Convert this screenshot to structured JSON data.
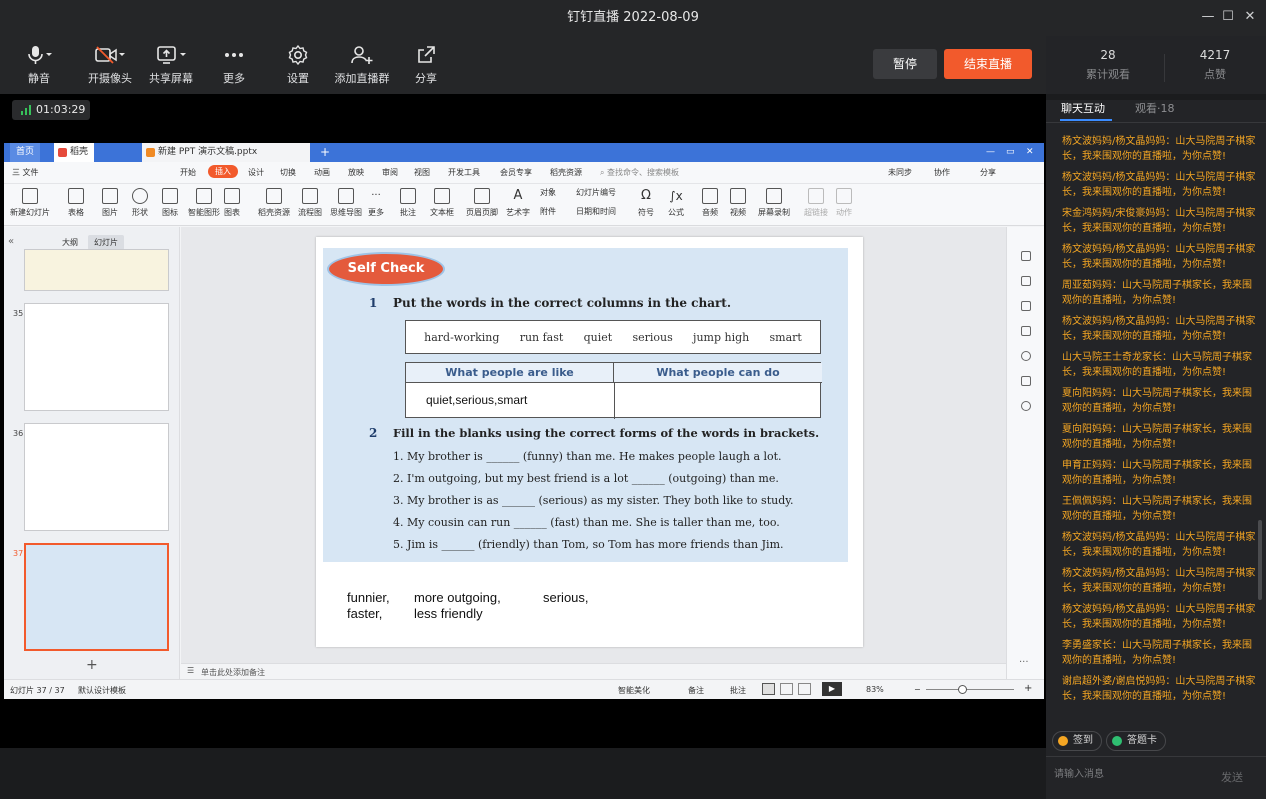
{
  "window": {
    "title": "钉钉直播 2022-08-09"
  },
  "toolbar": {
    "mute": "静音",
    "camera": "开摄像头",
    "share": "共享屏幕",
    "more": "更多",
    "settings": "设置",
    "add_group": "添加直播群",
    "share_link": "分享",
    "pause": "暂停",
    "end": "结束直播"
  },
  "stats": {
    "viewers": "28",
    "viewers_label": "累计观看",
    "likes": "4217",
    "likes_label": "点赞"
  },
  "timer": "01:03:29",
  "wps": {
    "tabs": {
      "home": "首页",
      "daoke": "稻壳",
      "doc": "新建 PPT 演示文稿.pptx"
    },
    "menu": [
      "三 文件",
      "开始",
      "插入",
      "设计",
      "切换",
      "动画",
      "放映",
      "审阅",
      "视图",
      "开发工具",
      "会员专享",
      "稻壳资源"
    ],
    "search": "查找命令、搜索模板",
    "right_menu": [
      "未同步",
      "协作",
      "分享"
    ],
    "ribbon": [
      "新建幻灯片",
      "表格",
      "图片",
      "形状",
      "图标",
      "智能图形",
      "图表",
      "稻壳资源",
      "流程图",
      "思维导图",
      "更多",
      "批注",
      "文本框",
      "页眉页脚",
      "艺术字",
      "对象",
      "幻灯片编号",
      "附件",
      "日期和时间",
      "符号",
      "公式",
      "音频",
      "视频",
      "屏幕录制",
      "超链接",
      "动作"
    ],
    "pane_tabs": {
      "outline": "大纲",
      "slides": "幻灯片"
    },
    "thumb_numbers": [
      "35",
      "36",
      "37"
    ],
    "notes_hint": "单击此处添加备注",
    "status": {
      "slide_count": "幻灯片 37 / 37",
      "template": "默认设计模板",
      "beautify": "智能美化",
      "notes": "备注",
      "comment": "批注",
      "zoom": "83%"
    }
  },
  "slide": {
    "self_check": "Self Check",
    "q1_num": "1",
    "q1_title": "Put the words in the correct columns in the chart.",
    "words": [
      "hard-working",
      "run fast",
      "quiet",
      "serious",
      "jump high",
      "smart"
    ],
    "col1": "What people are like",
    "col2": "What people can do",
    "col1_answer": "quiet,serious,smart",
    "q2_num": "2",
    "q2_title": "Fill in the blanks using the correct forms of the words in brackets.",
    "sentences": [
      "1. My brother is ______ (funny) than me. He makes people laugh a lot.",
      "2. I'm outgoing, but my best friend is a lot ______ (outgoing) than me.",
      "3. My brother is as ______ (serious) as my sister. They both like to study.",
      "4. My cousin can run ______ (fast) than me. She is taller than me, too.",
      "5. Jim is ______ (friendly) than Tom, so Tom has more friends than Jim."
    ],
    "answers_row1": [
      "funnier,",
      "more outgoing,",
      "serious,"
    ],
    "answers_row2": [
      "faster,",
      "less friendly"
    ]
  },
  "chat": {
    "tab_active": "聊天互动",
    "tab_watch": "观看·18",
    "messages": [
      "杨文波妈妈/杨文晶妈妈：山大马院周子棋家长，我来围观你的直播啦，为你点赞!",
      "杨文波妈妈/杨文晶妈妈：山大马院周子棋家长，我来围观你的直播啦，为你点赞!",
      "宋金鸿妈妈/宋俊豪妈妈：山大马院周子棋家长，我来围观你的直播啦，为你点赞!",
      "杨文波妈妈/杨文晶妈妈：山大马院周子棋家长，我来围观你的直播啦，为你点赞!",
      "周亚茹妈妈：山大马院周子棋家长，我来围观你的直播啦，为你点赞!",
      "杨文波妈妈/杨文晶妈妈：山大马院周子棋家长，我来围观你的直播啦，为你点赞!",
      "山大马院王士奇龙家长：山大马院周子棋家长，我来围观你的直播啦，为你点赞!",
      "夏向阳妈妈：山大马院周子棋家长，我来围观你的直播啦，为你点赞!",
      "夏向阳妈妈：山大马院周子棋家长，我来围观你的直播啦，为你点赞!",
      "申育正妈妈：山大马院周子棋家长，我来围观你的直播啦，为你点赞!",
      "王佩佩妈妈：山大马院周子棋家长，我来围观你的直播啦，为你点赞!",
      "杨文波妈妈/杨文晶妈妈：山大马院周子棋家长，我来围观你的直播啦，为你点赞!",
      "杨文波妈妈/杨文晶妈妈：山大马院周子棋家长，我来围观你的直播啦，为你点赞!",
      "杨文波妈妈/杨文晶妈妈：山大马院周子棋家长，我来围观你的直播啦，为你点赞!",
      "李勇盛家长：山大马院周子棋家长，我来围观你的直播啦，为你点赞!",
      "谢启超外婆/谢启悦妈妈：山大马院周子棋家长，我来围观你的直播啦，为你点赞!"
    ],
    "checkin": "签到",
    "answer_card": "答题卡",
    "input_placeholder": "请输入消息",
    "send": "发送"
  },
  "colors": {
    "accent": "#f25a2c",
    "chat_text": "#f4a623",
    "wps_blue": "#3c73d8"
  }
}
